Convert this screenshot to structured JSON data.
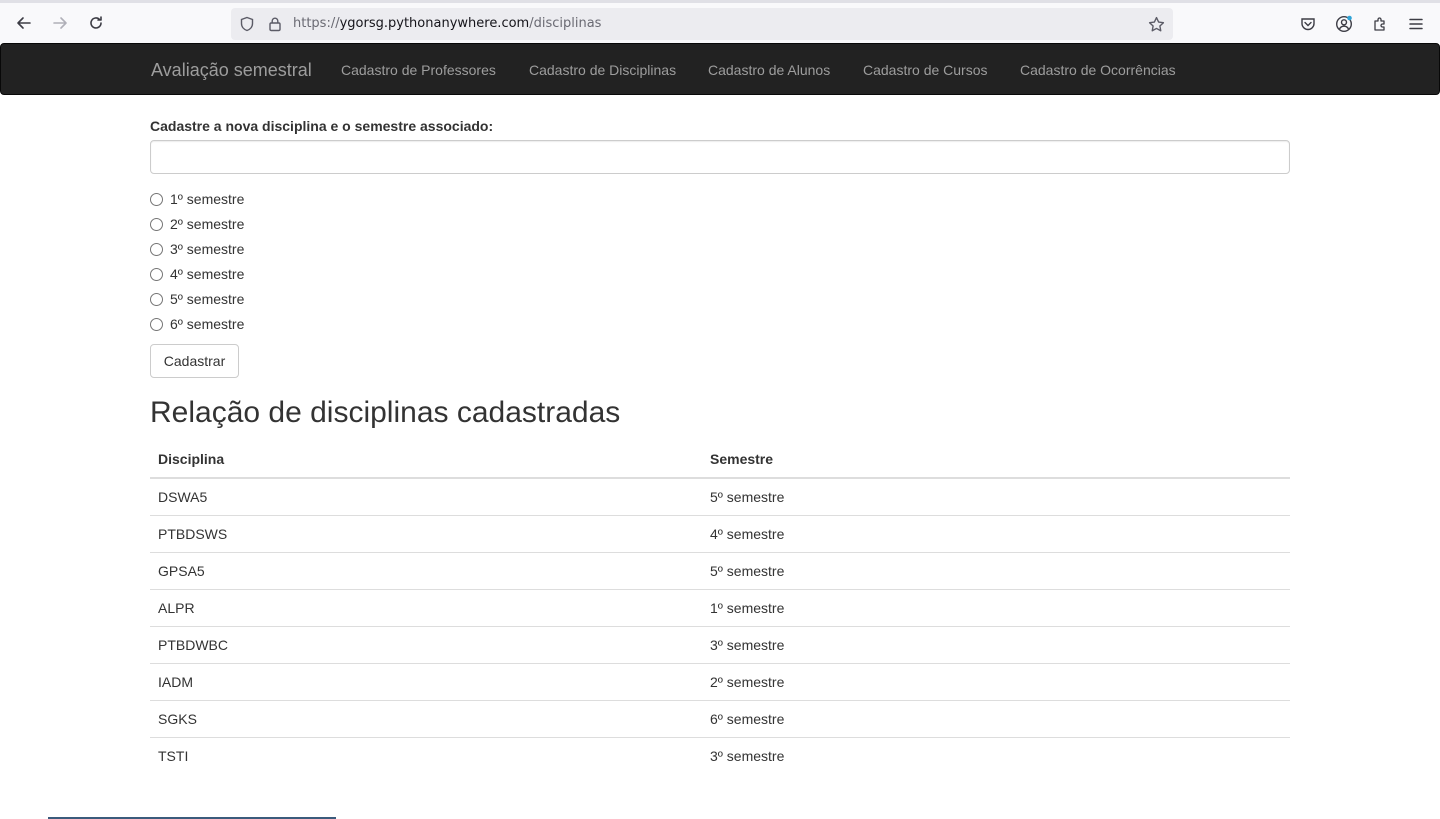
{
  "browser": {
    "url_prefix": "https://",
    "url_host": "ygorsg.pythonanywhere.com",
    "url_path": "/disciplinas"
  },
  "navbar": {
    "brand": "Avaliação semestral",
    "links": [
      "Cadastro de Professores",
      "Cadastro de Disciplinas",
      "Cadastro de Alunos",
      "Cadastro de Cursos",
      "Cadastro de Ocorrências"
    ]
  },
  "form": {
    "label": "Cadastre a nova disciplina e o semestre associado:",
    "input_value": "",
    "semesters": [
      "1º semestre",
      "2º semestre",
      "3º semestre",
      "4º semestre",
      "5º semestre",
      "6º semestre"
    ],
    "submit_label": "Cadastrar"
  },
  "list": {
    "title": "Relação de disciplinas cadastradas",
    "headers": [
      "Disciplina",
      "Semestre"
    ],
    "rows": [
      [
        "DSWA5",
        "5º semestre"
      ],
      [
        "PTBDSWS",
        "4º semestre"
      ],
      [
        "GPSA5",
        "5º semestre"
      ],
      [
        "ALPR",
        "1º semestre"
      ],
      [
        "PTBDWBC",
        "3º semestre"
      ],
      [
        "IADM",
        "2º semestre"
      ],
      [
        "SGKS",
        "6º semestre"
      ],
      [
        "TSTI",
        "3º semestre"
      ]
    ]
  }
}
